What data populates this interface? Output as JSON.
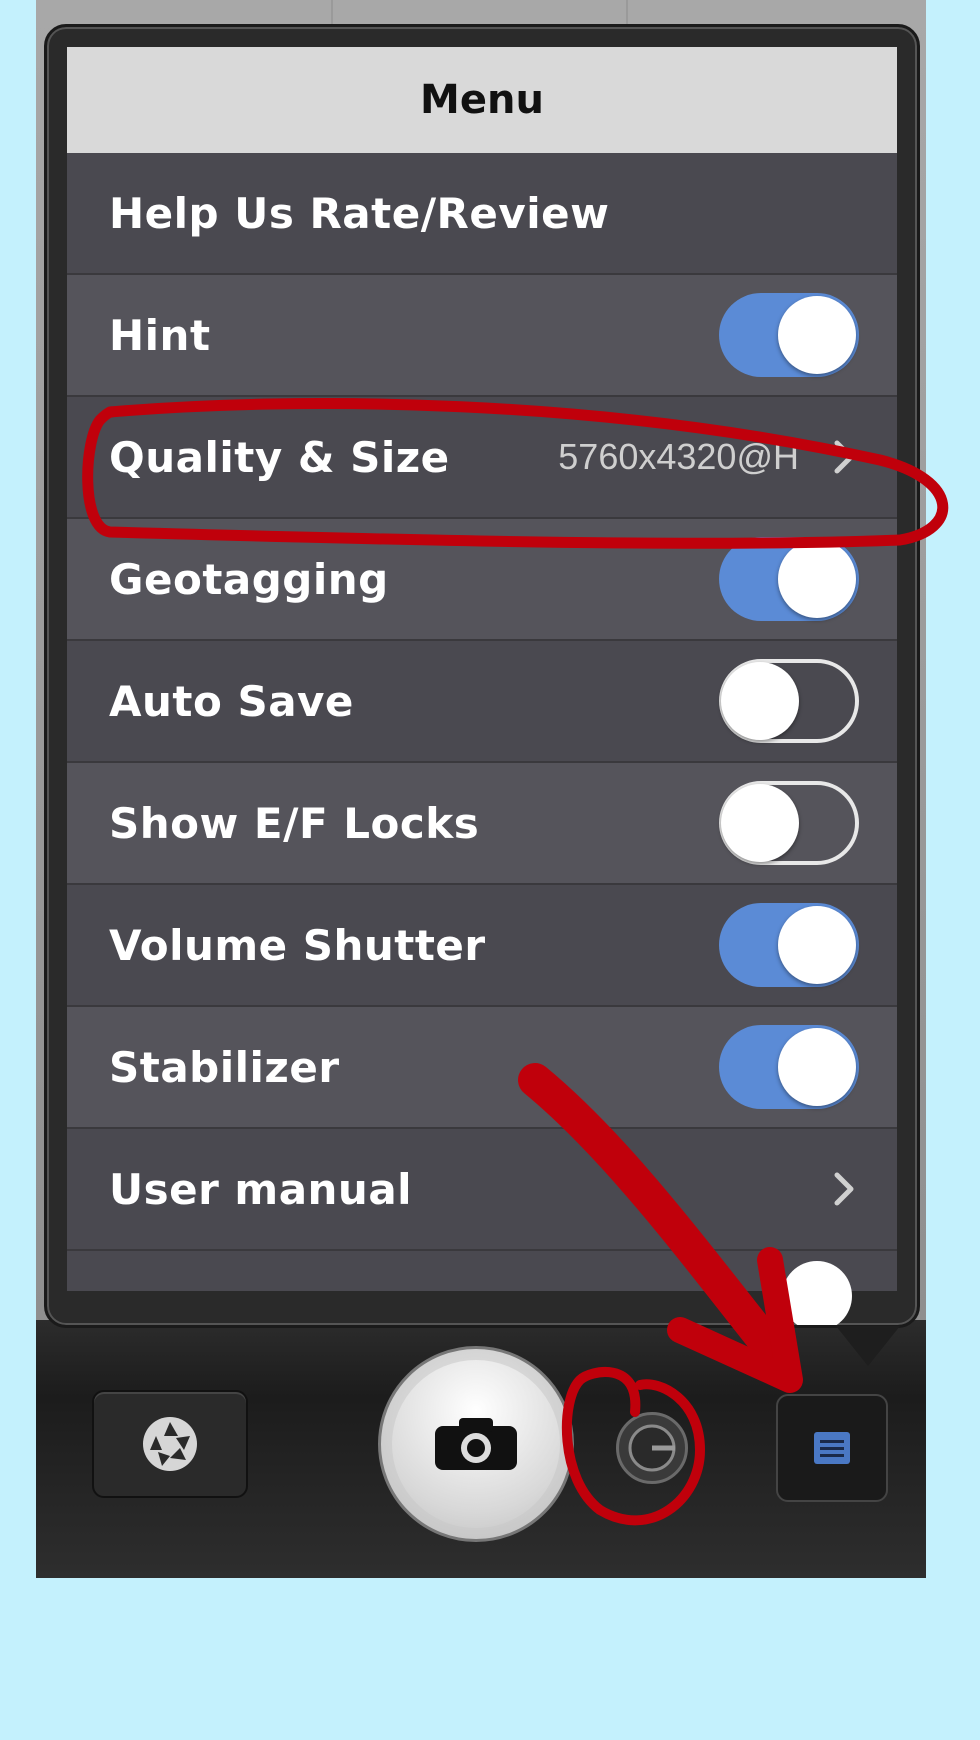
{
  "menu": {
    "title": "Menu",
    "items": [
      {
        "label": "Help Us Rate/Review",
        "type": "plain"
      },
      {
        "label": "Hint",
        "type": "toggle",
        "state": "on"
      },
      {
        "label": "Quality & Size",
        "type": "disclosure",
        "value": "5760x4320@H"
      },
      {
        "label": "Geotagging",
        "type": "toggle",
        "state": "on"
      },
      {
        "label": "Auto Save",
        "type": "toggle",
        "state": "off"
      },
      {
        "label": "Show E/F Locks",
        "type": "toggle",
        "state": "off"
      },
      {
        "label": "Volume Shutter",
        "type": "toggle",
        "state": "on"
      },
      {
        "label": "Stabilizer",
        "type": "toggle",
        "state": "on"
      },
      {
        "label": "User manual",
        "type": "disclosure"
      }
    ]
  },
  "toolbar": {
    "buttons": [
      "aperture-icon",
      "camera-icon",
      "timer-icon",
      "menu-list-icon"
    ]
  },
  "colors": {
    "toggle_on": "#5b8bd6",
    "annotation_red": "#c0000b",
    "page_background": "#c4f1fd"
  }
}
